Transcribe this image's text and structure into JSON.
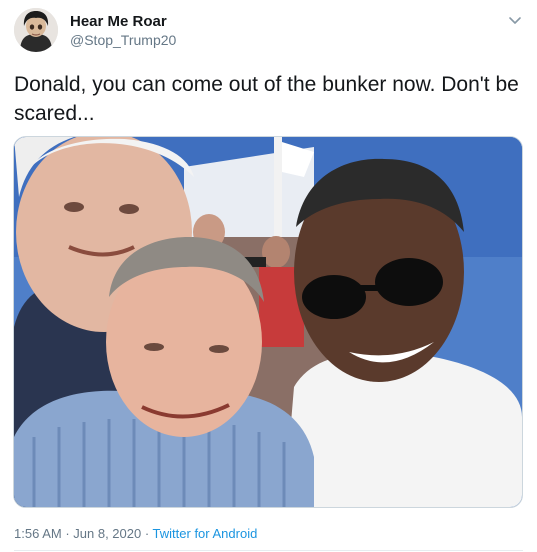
{
  "tweet": {
    "display_name": "Hear Me Roar",
    "handle": "@Stop_Trump20",
    "text": "Donald, you can come out of the bunker now. Don't be scared...",
    "time": "1:56 AM",
    "separator": " · ",
    "date": "Jun 8, 2020",
    "source": "Twitter for Android"
  },
  "icons": {
    "menu": "chevron-down-icon"
  },
  "colors": {
    "link": "#1b95e0",
    "muted": "#657786",
    "text": "#14171a"
  }
}
